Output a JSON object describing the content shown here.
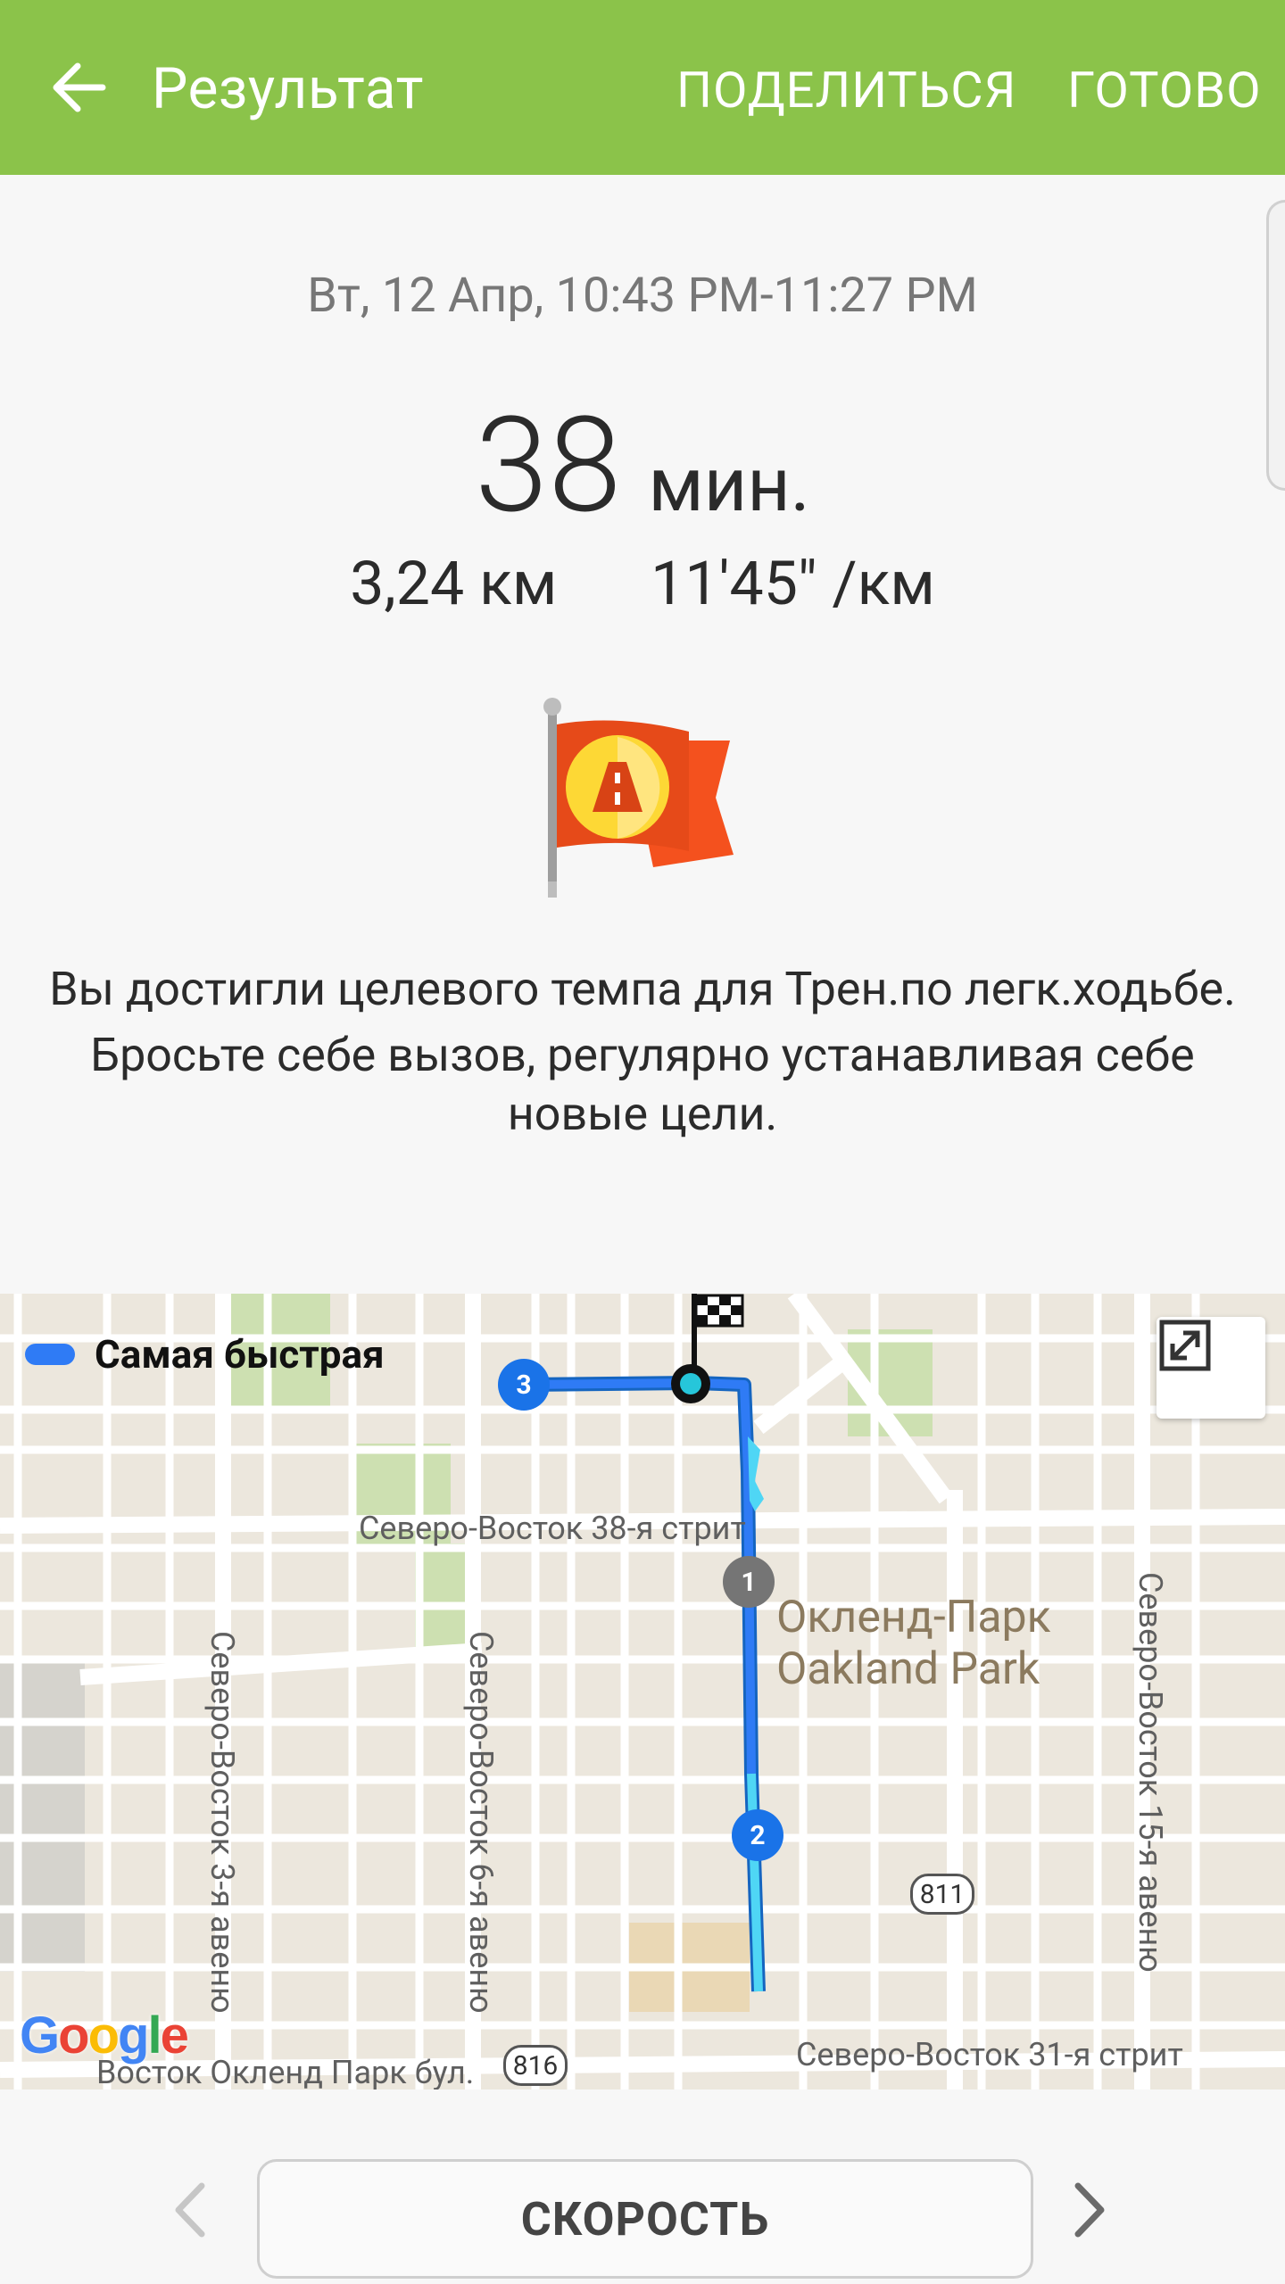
{
  "header": {
    "title": "Результат",
    "share_label": "ПОДЕЛИТЬСЯ",
    "done_label": "ГОТОВО",
    "back_icon": "arrow-left-icon",
    "background_color": "#8bc34a"
  },
  "summary": {
    "datetime": "Вт, 12 Апр, 10:43 PM-11:27 PM",
    "duration_value": "38",
    "duration_unit": "мин.",
    "distance": "3,24 км",
    "pace": "11'45\" /км"
  },
  "achievement": {
    "icon": "target-pace-flag-icon",
    "line1": "Вы достигли целевого темпа для Трен.по легк.ходьбе.",
    "line2": "Бросьте себе вызов, регулярно устанавливая себе новые цели."
  },
  "map": {
    "legend_label": "Самая быстрая",
    "legend_color": "#2f7bf5",
    "expand_icon": "expand-icon",
    "area_label_ru": "Окленд-Парк",
    "area_label_en": "Oakland Park",
    "streets": {
      "ne38": "Северо-Восток 38-я стрит",
      "ne31": "Северо-Восток 31-я стрит",
      "ne3ave": "Северо-Восток 3-я авеню",
      "ne6ave": "Северо-Восток 6-я авеню",
      "ne15ave": "Северо-Восток 15-я авеню",
      "oakland_blvd": "Восток Окленд Парк бул."
    },
    "shields": {
      "r811": "811",
      "r816": "816"
    },
    "markers": {
      "m1": "1",
      "m2": "2",
      "m3": "3"
    },
    "finish_icon": "checkered-flag-icon",
    "attribution": "Google"
  },
  "bottom": {
    "mode_label": "СКОРОСТЬ",
    "prev_icon": "chevron-left-icon",
    "next_icon": "chevron-right-icon"
  }
}
